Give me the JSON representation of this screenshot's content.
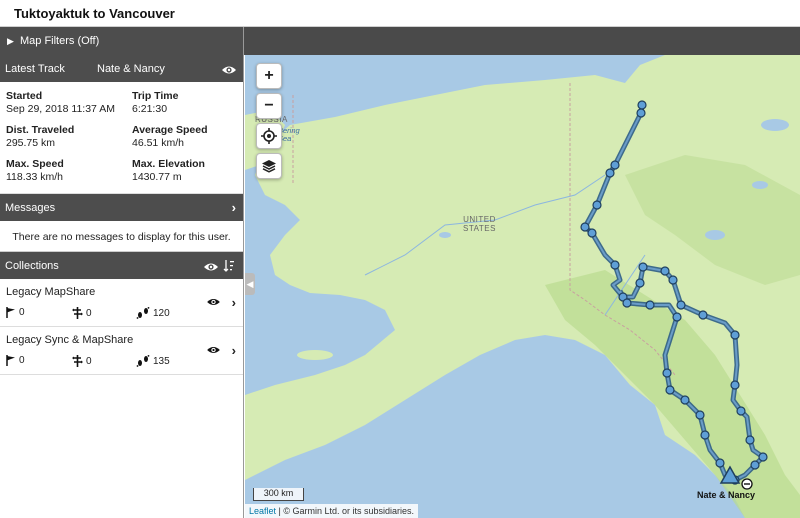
{
  "window": {
    "title": "Tuktoyaktuk to Vancouver"
  },
  "filters": {
    "label": "Map Filters (Off)"
  },
  "latest_track": {
    "header": "Latest Track",
    "user": "Nate & Nancy",
    "started_label": "Started",
    "started_value": "Sep 29, 2018 11:37 AM",
    "trip_time_label": "Trip Time",
    "trip_time_value": "6:21:30",
    "distance_label": "Dist. Traveled",
    "distance_value": "295.75 km",
    "avg_speed_label": "Average Speed",
    "avg_speed_value": "46.51 km/h",
    "max_speed_label": "Max. Speed",
    "max_speed_value": "118.33 km/h",
    "max_elev_label": "Max. Elevation",
    "max_elev_value": "1430.77 m"
  },
  "messages": {
    "header": "Messages",
    "empty_text": "There are no messages to display for this user."
  },
  "collections": {
    "header": "Collections",
    "items": [
      {
        "name": "Legacy MapShare",
        "waypoints": "0",
        "routes": "0",
        "tracks": "120"
      },
      {
        "name": "Legacy Sync & MapShare",
        "waypoints": "0",
        "routes": "0",
        "tracks": "135"
      }
    ]
  },
  "map": {
    "zoom_in": "+",
    "zoom_out": "−",
    "labels": {
      "russia": "RUSSIA",
      "united_states": "UNITED\nSTATES",
      "sea": "Bering\nSea"
    },
    "scale": "300 km",
    "attribution_link": "Leaflet",
    "attribution_text": " | © Garmin Ltd. or its subsidiaries.",
    "marker_label": "Nate & Nancy"
  },
  "colors": {
    "panel_header": "#4d4d4d",
    "water": "#a8c9e5",
    "land": "#d6ebb4",
    "track": "#2e5d86",
    "track_point": "#5f9fd6"
  },
  "icons": [
    "eye-icon",
    "chevron-right-icon",
    "sort-icon",
    "flag-icon",
    "route-icon",
    "footprints-icon",
    "locate-icon",
    "layers-icon",
    "triangle-marker-icon"
  ]
}
